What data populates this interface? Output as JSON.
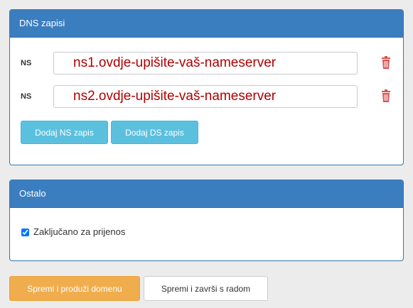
{
  "dns_panel": {
    "title": "DNS zapisi",
    "records": [
      {
        "label": "NS",
        "value": "ns1.ovdje-upišite-vaš-nameserver"
      },
      {
        "label": "NS",
        "value": "ns2.ovdje-upišite-vaš-nameserver"
      }
    ],
    "add_ns_label": "Dodaj NS zapis",
    "add_ds_label": "Dodaj DS zapis"
  },
  "other_panel": {
    "title": "Ostalo",
    "lock_label": "Zaključano za prijenos",
    "lock_checked": true
  },
  "actions": {
    "save_renew_label": "Spremi i produži domenu",
    "save_finish_label": "Spremi i završi s radom"
  },
  "colors": {
    "panel_header": "#3b7ec0",
    "info_button": "#5bc0de",
    "warning_button": "#f0ad4e",
    "trash_icon": "#d9534f",
    "input_text": "#b00000"
  },
  "icons": {
    "delete": "trash-icon"
  }
}
